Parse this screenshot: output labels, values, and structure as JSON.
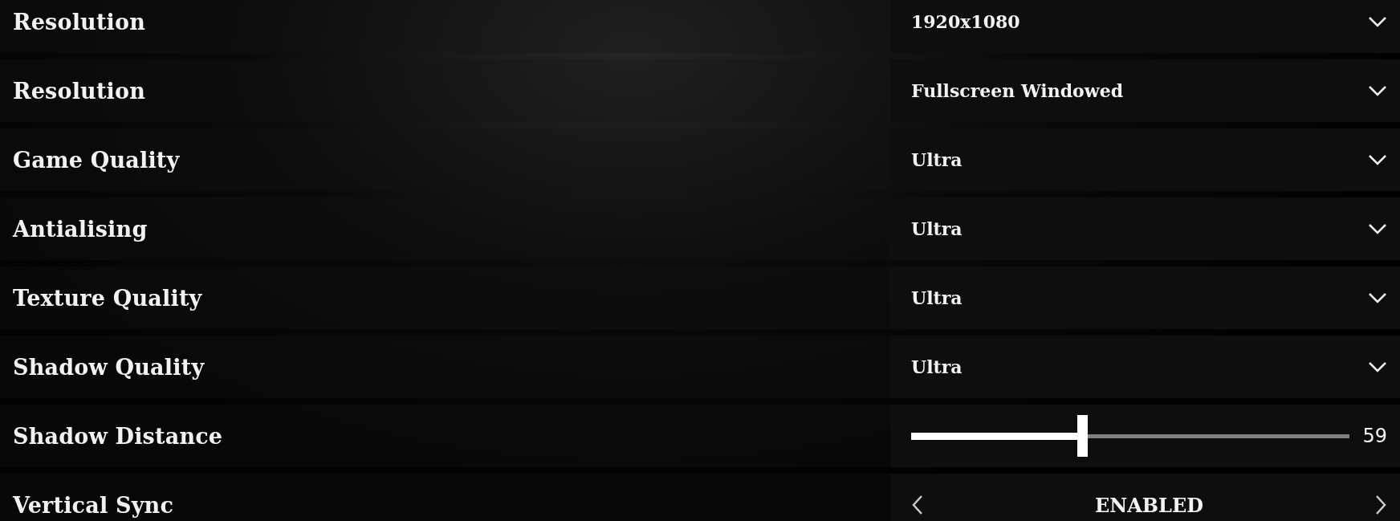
{
  "settings": [
    {
      "kind": "dropdown",
      "label": "Resolution",
      "value": "1920x1080"
    },
    {
      "kind": "dropdown",
      "label": "Resolution",
      "value": "Fullscreen Windowed"
    },
    {
      "kind": "dropdown",
      "label": "Game Quality",
      "value": "Ultra"
    },
    {
      "kind": "dropdown",
      "label": "Antialising",
      "value": "Ultra"
    },
    {
      "kind": "dropdown",
      "label": "Texture Quality",
      "value": "Ultra"
    },
    {
      "kind": "dropdown",
      "label": "Shadow Quality",
      "value": "Ultra"
    },
    {
      "kind": "slider",
      "label": "Shadow Distance",
      "level": 0.39,
      "reading": "59"
    },
    {
      "kind": "toggle",
      "label": "Vertical Sync",
      "value": "ENABLED"
    }
  ]
}
